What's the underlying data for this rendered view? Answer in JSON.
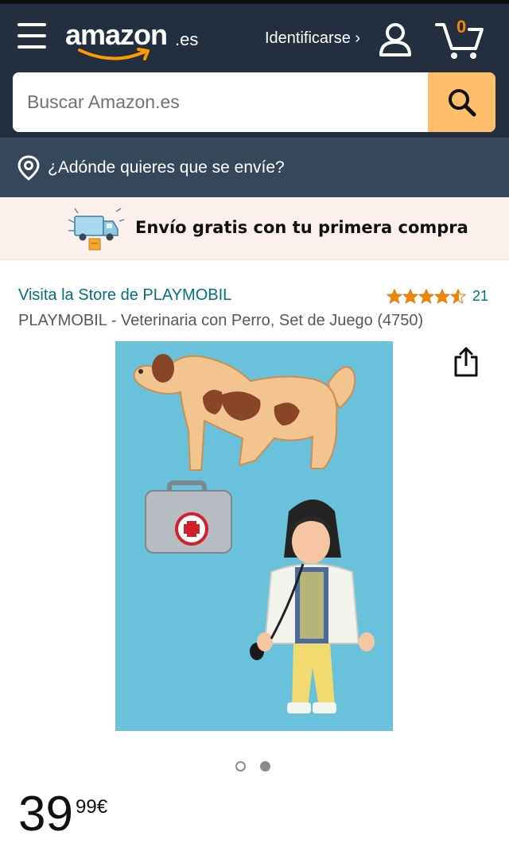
{
  "header": {
    "logo_text": "amazon",
    "logo_tld": ".es",
    "signin_label": "Identificarse ›",
    "cart_count": "0",
    "icons": [
      "menu-icon",
      "user-icon",
      "cart-icon"
    ]
  },
  "search": {
    "placeholder": "Buscar Amazon.es",
    "value": "",
    "button_icon": "search-icon"
  },
  "location": {
    "icon": "location-pin-icon",
    "label": "¿Adónde quieres que se envíe?"
  },
  "promo": {
    "icon": "delivery-truck-icon",
    "text": "Envío gratis con tu primera compra"
  },
  "product": {
    "store_link": "Visita la Store de PLAYMOBIL",
    "rating_stars": 4.5,
    "rating_count": "21",
    "title": "PLAYMOBIL - Veterinaria con Perro, Set de Juego (4750)",
    "image_slide_count": 2,
    "active_slide": 2,
    "price_whole": "39",
    "price_fraction": "99",
    "price_currency": "€"
  },
  "colors": {
    "header_bg": "#232f3e",
    "location_bg": "#37475a",
    "search_button": "#febd69",
    "link": "#007185",
    "star": "#f08804",
    "promo_bg": "#fcf0ed",
    "product_bg": "#69c1dc"
  }
}
